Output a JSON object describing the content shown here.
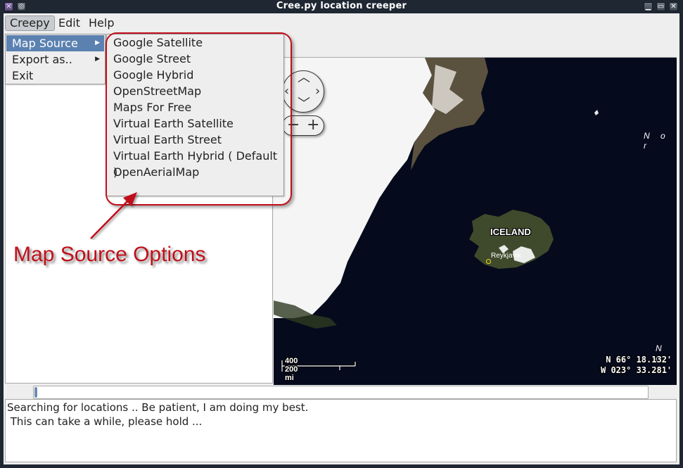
{
  "window": {
    "title": "Cree.py location creeper",
    "left_icons": [
      "app-x-icon",
      "pin-icon"
    ],
    "controls": [
      "minimize-icon",
      "maximize-icon",
      "close-icon"
    ]
  },
  "menubar": {
    "items": [
      {
        "label": "Creepy",
        "active": true
      },
      {
        "label": "Edit",
        "active": false
      },
      {
        "label": "Help",
        "active": false
      }
    ]
  },
  "creepy_menu": {
    "items": [
      {
        "label": "Map Source",
        "has_submenu": true,
        "highlighted": true
      },
      {
        "label": "Export as..",
        "has_submenu": true,
        "highlighted": false
      },
      {
        "label": "Exit",
        "has_submenu": false,
        "highlighted": false
      }
    ]
  },
  "map_source_submenu": {
    "items": [
      "Google Satellite",
      "Google Street",
      "Google Hybrid",
      "OpenStreetMap",
      "Maps For Free",
      "Virtual Earth Satellite",
      "Virtual Earth Street",
      "Virtual Earth Hybrid ( Default )",
      "OpenAerialMap"
    ]
  },
  "annotation": {
    "text": "Map Source Options",
    "color": "#c0101a"
  },
  "map": {
    "controls": {
      "pan": [
        "up",
        "down",
        "left",
        "right"
      ],
      "zoom": [
        "zoom-out",
        "zoom-in"
      ]
    },
    "labels": {
      "country": "ICELAND",
      "city": "Reykjavik",
      "sea_top": "N o r",
      "sea_bottom": "N o"
    },
    "scale": {
      "km": "400 km",
      "mi": "200 mi"
    },
    "coordinates": {
      "lat": "N 66° 18.132'",
      "lon": "W 023° 33.281'"
    }
  },
  "progress": {
    "value_percent": 0
  },
  "log": {
    "lines": [
      "Searching for locations .. Be patient, I am doing my best.",
      " This can take a while, please hold ..."
    ]
  }
}
